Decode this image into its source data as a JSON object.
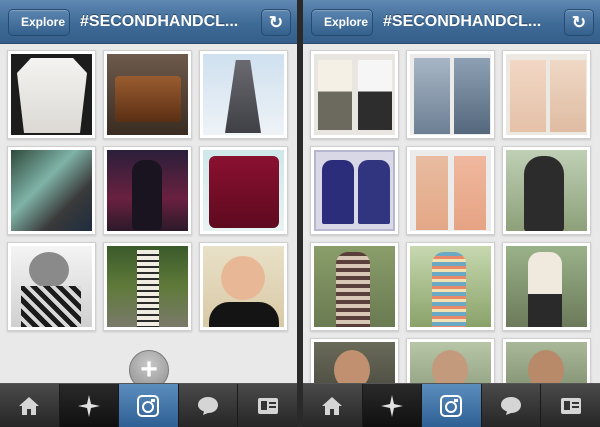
{
  "screens": [
    {
      "back_label": "Explore",
      "title": "#SECONDHANDCL...",
      "refresh_icon": "refresh-icon",
      "add_button_icon": "plus-icon",
      "tabs": [
        "home-icon",
        "explore-icon",
        "camera-icon",
        "news-icon",
        "profile-icon"
      ],
      "active_tab": 2
    },
    {
      "back_label": "Explore",
      "title": "#SECONDHANDCL...",
      "refresh_icon": "refresh-icon",
      "tabs": [
        "home-icon",
        "explore-icon",
        "camera-icon",
        "news-icon",
        "profile-icon"
      ],
      "active_tab": 2
    }
  ],
  "colors": {
    "nav_blue": "#3f6b98",
    "active_tab_blue": "#4a7dae",
    "background": "#e9e9e9"
  }
}
